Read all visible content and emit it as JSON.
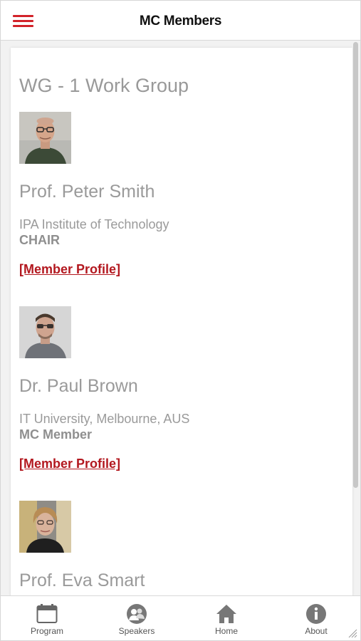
{
  "header": {
    "title": "MC Members"
  },
  "group": {
    "title": "WG - 1 Work Group"
  },
  "members": [
    {
      "name": "Prof. Peter Smith",
      "affiliation": "IPA Institute of Technology",
      "role": "CHAIR",
      "link": "[Member Profile]"
    },
    {
      "name": "Dr. Paul Brown",
      "affiliation": "IT University, Melbourne, AUS",
      "role": "MC Member",
      "link": "[Member Profile]"
    },
    {
      "name": "Prof. Eva Smart"
    }
  ],
  "tabs": [
    {
      "label": "Program",
      "icon": "calendar-icon"
    },
    {
      "label": "Speakers",
      "icon": "speakers-icon"
    },
    {
      "label": "Home",
      "icon": "home-icon"
    },
    {
      "label": "About",
      "icon": "info-icon"
    }
  ],
  "colors": {
    "accent": "#b3181f",
    "menu": "#d2232a",
    "text_muted": "#9a9a9a"
  }
}
